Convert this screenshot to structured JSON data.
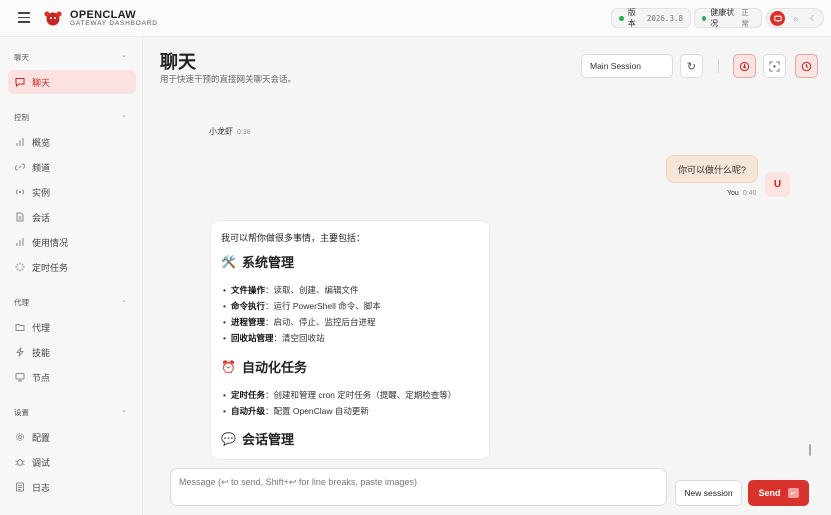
{
  "header": {
    "brand_name": "OPENCLAW",
    "brand_sub": "GATEWAY DASHBOARD",
    "version_label": "版本",
    "version_value": "2026.3.8",
    "health_label": "健康状况",
    "health_value": "正常",
    "status_color": "#22b14c",
    "accent_color": "#d9312c"
  },
  "sidebar": {
    "sections": [
      {
        "title": "聊天",
        "items": [
          {
            "label": "聊天",
            "icon": "chat-icon",
            "active": true
          }
        ]
      },
      {
        "title": "控制",
        "items": [
          {
            "label": "概览",
            "icon": "bar-chart-icon"
          },
          {
            "label": "频道",
            "icon": "link-icon"
          },
          {
            "label": "实例",
            "icon": "broadcast-icon"
          },
          {
            "label": "会话",
            "icon": "document-icon"
          },
          {
            "label": "使用情况",
            "icon": "bar-chart-icon"
          },
          {
            "label": "定时任务",
            "icon": "loader-icon"
          }
        ]
      },
      {
        "title": "代理",
        "items": [
          {
            "label": "代理",
            "icon": "folder-icon"
          },
          {
            "label": "技能",
            "icon": "lightning-icon"
          },
          {
            "label": "节点",
            "icon": "monitor-icon"
          }
        ]
      },
      {
        "title": "设置",
        "items": [
          {
            "label": "配置",
            "icon": "gear-icon"
          },
          {
            "label": "调试",
            "icon": "bug-icon"
          },
          {
            "label": "日志",
            "icon": "log-icon"
          }
        ]
      }
    ]
  },
  "main": {
    "title": "聊天",
    "subtitle": "用于快速干预的直接网关聊天会话。",
    "session_select": "Main Session"
  },
  "chat": {
    "bot_name": "小龙虾",
    "bot_time": "0:38",
    "user_message": "你可以做什么呢?",
    "user_avatar": "U",
    "user_name": "You",
    "user_time": "0:40",
    "assistant": {
      "intro": "我可以帮你做很多事情，主要包括：",
      "sections": [
        {
          "emoji": "🛠️",
          "heading": "系统管理",
          "items": [
            {
              "bold": "文件操作",
              "text": "：读取、创建、编辑文件"
            },
            {
              "bold": "命令执行",
              "text": "：运行 PowerShell 命令、脚本"
            },
            {
              "bold": "进程管理",
              "text": "：启动、停止、监控后台进程"
            },
            {
              "bold": "回收站管理",
              "text": "：清空回收站"
            }
          ]
        },
        {
          "emoji": "⏰",
          "heading": "自动化任务",
          "items": [
            {
              "bold": "定时任务",
              "text": "：创建和管理 cron 定时任务（提醒、定期检查等）"
            },
            {
              "bold": "自动升级",
              "text": "：配置 OpenClaw 自动更新"
            }
          ]
        },
        {
          "emoji": "💬",
          "heading": "会话管理",
          "items": []
        }
      ]
    }
  },
  "composer": {
    "placeholder": "Message (↩ to send, Shift+↩ for line breaks, paste images)",
    "new_session_label": "New session",
    "send_label": "Send"
  }
}
